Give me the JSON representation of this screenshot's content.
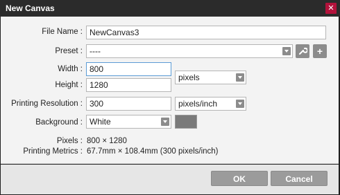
{
  "window": {
    "title": "New Canvas",
    "close_glyph": "✕"
  },
  "form": {
    "file_name": {
      "label": "File Name :",
      "value": "NewCanvas3"
    },
    "preset": {
      "label": "Preset :",
      "value": "----",
      "edit_icon": "wrench-icon",
      "add_icon": "plus-icon"
    },
    "width": {
      "label": "Width :",
      "value": "800"
    },
    "height": {
      "label": "Height :",
      "value": "1280"
    },
    "size_unit": {
      "value": "pixels"
    },
    "printing_resolution": {
      "label": "Printing Resolution :",
      "value": "300",
      "unit": "pixels/inch"
    },
    "background": {
      "label": "Background :",
      "value": "White",
      "swatch_color": "#7a7a7a"
    }
  },
  "info": {
    "pixels": {
      "label": "Pixels :",
      "value": "800 × 1280"
    },
    "printing_metrics": {
      "label": "Printing Metrics :",
      "value": "67.7mm × 108.4mm (300 pixels/inch)"
    }
  },
  "buttons": {
    "ok": "OK",
    "cancel": "Cancel"
  }
}
